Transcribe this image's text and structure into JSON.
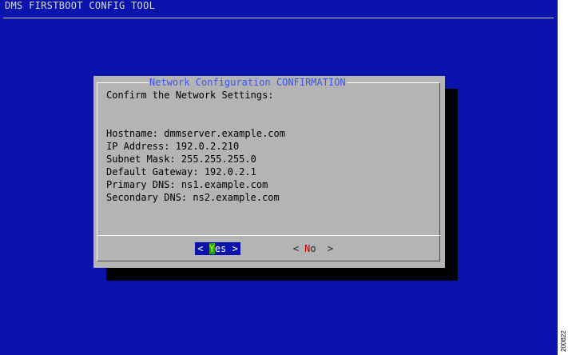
{
  "app": {
    "title": "DMS FIRSTBOOT CONFIG TOOL"
  },
  "dialog": {
    "title": "Network Configuration CONFIRMATION",
    "prompt": "Confirm the Network Settings:",
    "lines": [
      "Hostname: dmmserver.example.com",
      "IP Address: 192.0.2.210",
      "Subnet Mask: 255.255.255.0",
      "Default Gateway: 192.0.2.1",
      "Primary DNS: ns1.example.com",
      "Secondary DNS: ns2.example.com"
    ],
    "buttons": {
      "yes": {
        "open": "< ",
        "hotkey": "Y",
        "rest": "es",
        "close": " >"
      },
      "no": {
        "open": "< ",
        "hotkey": "N",
        "rest": "o",
        "close": "  >"
      }
    }
  },
  "figure_id": "200822",
  "colors": {
    "background": "#0a14ad",
    "dialog": "#b4b4b4",
    "dialog_title": "#3b55ef",
    "selected_button": "#0a14ad",
    "hotkey_highlight": "#1fa11f",
    "no_hotkey": "#c00000"
  }
}
